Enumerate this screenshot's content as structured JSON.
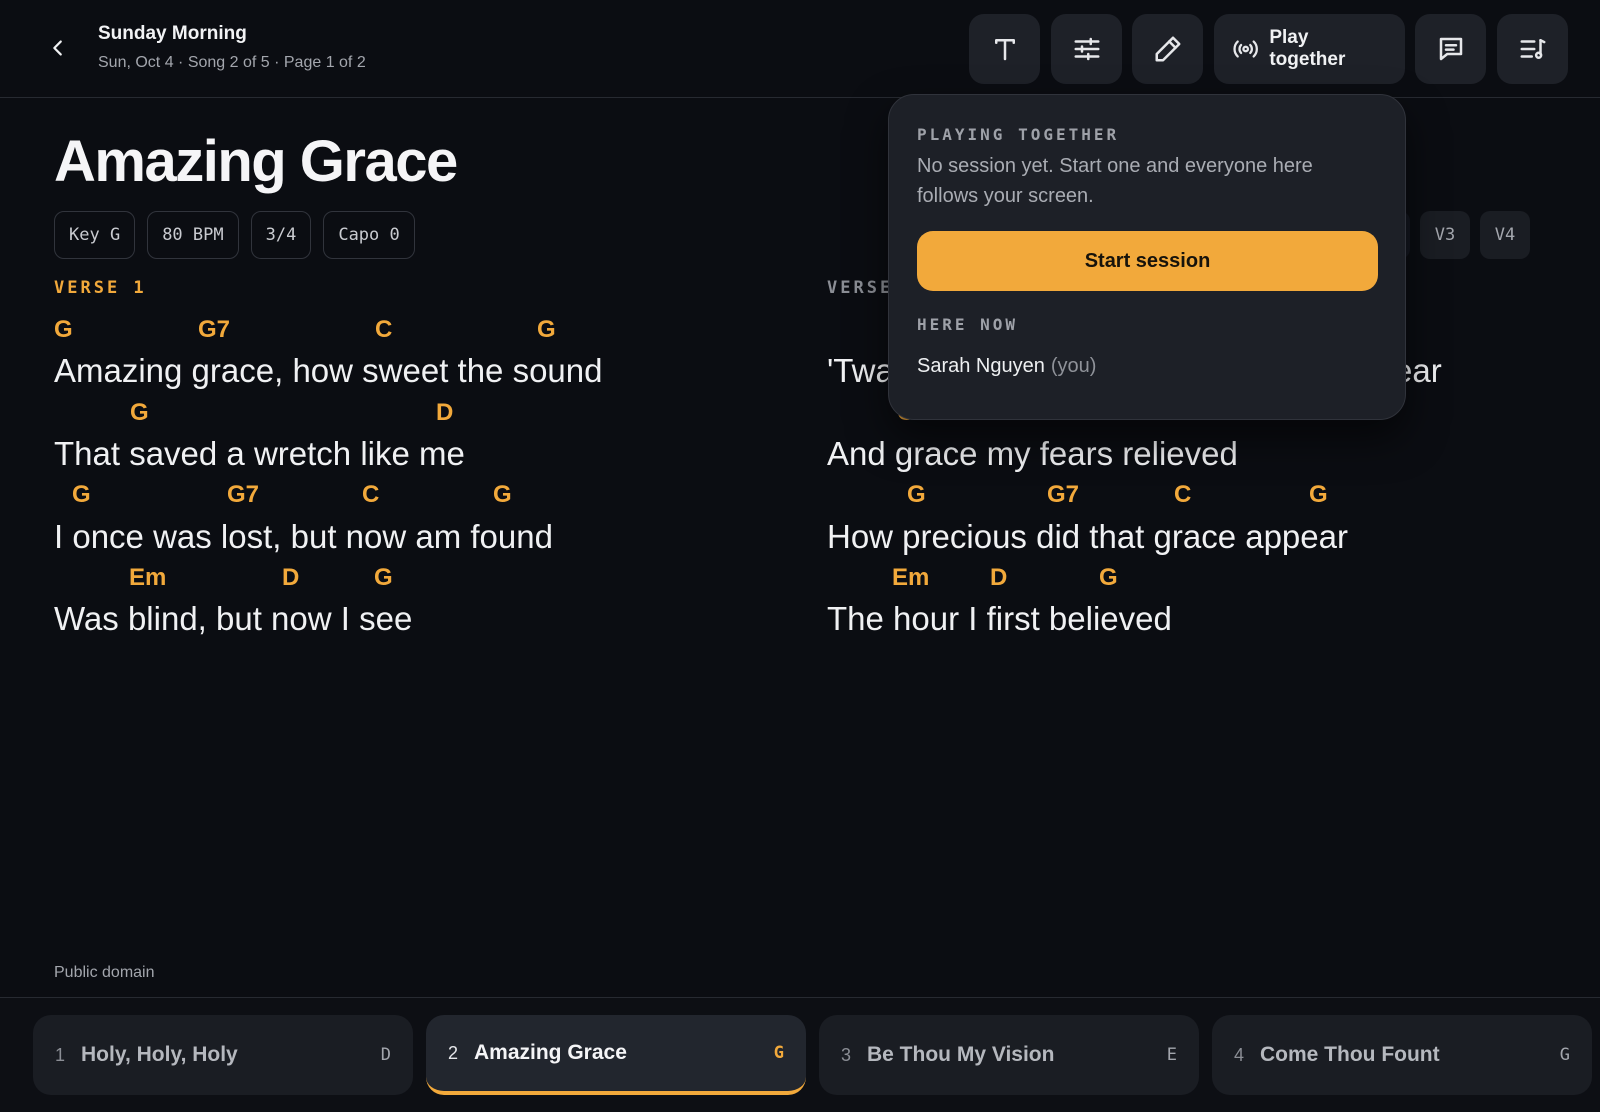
{
  "header": {
    "set_title": "Sunday Morning",
    "set_subtitle": "Sun, Oct 4 · Song 2 of 5 · Page 1 of 2",
    "play_together_label": "Play together",
    "icons": [
      "chevron-left-icon",
      "text-size-icon",
      "sliders-icon",
      "pencil-icon",
      "broadcast-icon",
      "message-icon",
      "setlist-icon"
    ]
  },
  "song": {
    "title": "Amazing Grace",
    "meta": [
      "Key G",
      "80 BPM",
      "3/4",
      "Capo 0"
    ],
    "verse_chips": [
      "V3",
      "V4"
    ],
    "credit": "Public domain",
    "sections": [
      {
        "label": "VERSE 1",
        "lines": [
          {
            "chords": [
              "G",
              "G7",
              "C",
              "G"
            ],
            "text": "Amazing grace, how sweet the sound"
          },
          {
            "chords": [
              "G",
              "D"
            ],
            "text": "That saved a wretch like me"
          },
          {
            "chords": [
              "G",
              "G7",
              "C",
              "G"
            ],
            "text": "I once was lost, but now am found"
          },
          {
            "chords": [
              "Em",
              "D",
              "G"
            ],
            "text": "Was blind, but now I see"
          }
        ]
      },
      {
        "label": "VERSE",
        "lines": [
          {
            "chords": [],
            "text_start": "'Twa",
            "text_end": "ear"
          },
          {
            "chords": [
              "G",
              "G"
            ],
            "text": "And grace my fears relieved"
          },
          {
            "chords": [
              "G",
              "G7",
              "C",
              "G"
            ],
            "text": "How precious did that grace appear"
          },
          {
            "chords": [
              "Em",
              "D",
              "G"
            ],
            "text": "The hour I first believed"
          }
        ]
      }
    ]
  },
  "popover": {
    "heading": "PLAYING TOGETHER",
    "description": "No session yet. Start one and everyone here follows your screen.",
    "start_button": "Start session",
    "here_now_label": "HERE NOW",
    "member_name": "Sarah Nguyen",
    "member_suffix": "(you)"
  },
  "setlist": [
    {
      "num": "1",
      "name": "Holy, Holy, Holy",
      "key": "D",
      "active": false
    },
    {
      "num": "2",
      "name": "Amazing Grace",
      "key": "G",
      "active": true
    },
    {
      "num": "3",
      "name": "Be Thou My Vision",
      "key": "E",
      "active": false
    },
    {
      "num": "4",
      "name": "Come Thou Fount",
      "key": "G",
      "active": false
    }
  ],
  "colors": {
    "accent": "#f2a93b",
    "background": "#0b0d12",
    "surface": "#1d2027"
  }
}
